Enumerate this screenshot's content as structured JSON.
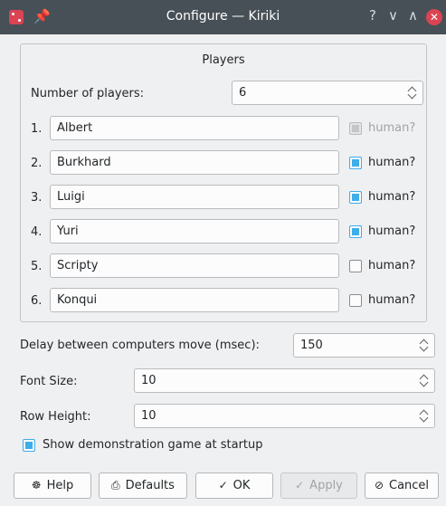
{
  "window": {
    "title": "Configure — Kiriki",
    "help_glyph": "?",
    "minimize_glyph": "∨",
    "maximize_glyph": "∧",
    "close_glyph": "✕",
    "pin_glyph": "📌"
  },
  "players_group": {
    "title": "Players",
    "num_players_label": "Number of players:",
    "num_players_value": "6",
    "checkbox_label": "human?",
    "players": [
      {
        "index": "1.",
        "name": "Albert",
        "human": true,
        "enabled": false
      },
      {
        "index": "2.",
        "name": "Burkhard",
        "human": true,
        "enabled": true
      },
      {
        "index": "3.",
        "name": "Luigi",
        "human": true,
        "enabled": true
      },
      {
        "index": "4.",
        "name": "Yuri",
        "human": true,
        "enabled": true
      },
      {
        "index": "5.",
        "name": "Scripty",
        "human": false,
        "enabled": true
      },
      {
        "index": "6.",
        "name": "Konqui",
        "human": false,
        "enabled": true
      }
    ]
  },
  "settings": {
    "delay_label": "Delay between computers move (msec):",
    "delay_value": "150",
    "font_size_label": "Font Size:",
    "font_size_value": "10",
    "row_height_label": "Row Height:",
    "row_height_value": "10",
    "demo_label": "Show demonstration game at startup",
    "demo_checked": true
  },
  "buttons": {
    "help": {
      "label": "Help",
      "icon": "help-icon",
      "glyph": "☸"
    },
    "defaults": {
      "label": "Defaults",
      "icon": "defaults-icon",
      "glyph": "⎙"
    },
    "ok": {
      "label": "OK",
      "icon": "check-icon",
      "glyph": "✓"
    },
    "apply": {
      "label": "Apply",
      "icon": "check-icon",
      "glyph": "✓"
    },
    "cancel": {
      "label": "Cancel",
      "icon": "cancel-icon",
      "glyph": "⊘"
    }
  },
  "colors": {
    "accent": "#3daee9",
    "titlebar": "#475057",
    "close": "#da4453",
    "window_bg": "#eff0f1"
  }
}
